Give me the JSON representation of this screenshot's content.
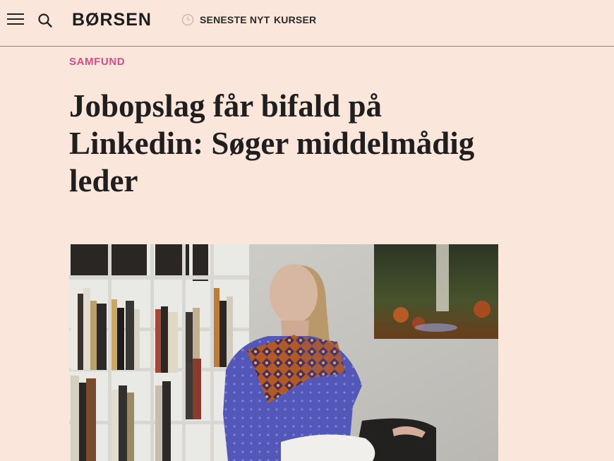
{
  "header": {
    "logo": "BØRSEN",
    "nav": [
      {
        "label": "SENESTE NYT"
      },
      {
        "label": "KURSER"
      }
    ]
  },
  "article": {
    "section": "SAMFUND",
    "headline": "Jobopslag får bifald på Linkedin: Søger middelmådig leder"
  },
  "colors": {
    "background": "#fbe6dc",
    "section_accent": "#d94d84"
  }
}
